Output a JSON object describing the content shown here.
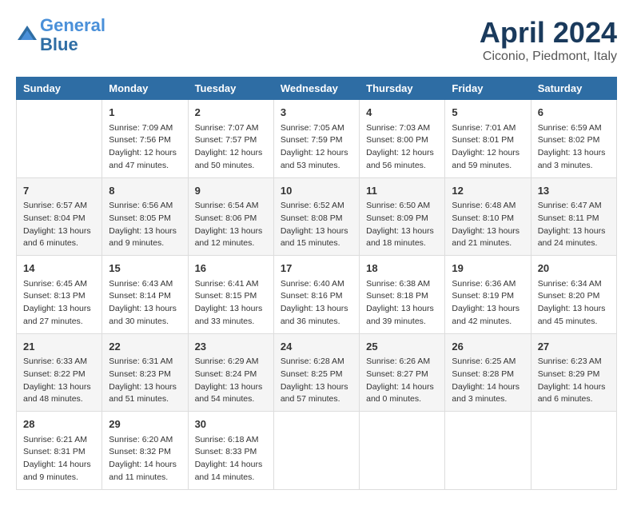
{
  "header": {
    "logo_line1": "General",
    "logo_line2": "Blue",
    "title": "April 2024",
    "subtitle": "Ciconio, Piedmont, Italy"
  },
  "days_of_week": [
    "Sunday",
    "Monday",
    "Tuesday",
    "Wednesday",
    "Thursday",
    "Friday",
    "Saturday"
  ],
  "weeks": [
    [
      {
        "day": "",
        "info": ""
      },
      {
        "day": "1",
        "info": "Sunrise: 7:09 AM\nSunset: 7:56 PM\nDaylight: 12 hours\nand 47 minutes."
      },
      {
        "day": "2",
        "info": "Sunrise: 7:07 AM\nSunset: 7:57 PM\nDaylight: 12 hours\nand 50 minutes."
      },
      {
        "day": "3",
        "info": "Sunrise: 7:05 AM\nSunset: 7:59 PM\nDaylight: 12 hours\nand 53 minutes."
      },
      {
        "day": "4",
        "info": "Sunrise: 7:03 AM\nSunset: 8:00 PM\nDaylight: 12 hours\nand 56 minutes."
      },
      {
        "day": "5",
        "info": "Sunrise: 7:01 AM\nSunset: 8:01 PM\nDaylight: 12 hours\nand 59 minutes."
      },
      {
        "day": "6",
        "info": "Sunrise: 6:59 AM\nSunset: 8:02 PM\nDaylight: 13 hours\nand 3 minutes."
      }
    ],
    [
      {
        "day": "7",
        "info": "Sunrise: 6:57 AM\nSunset: 8:04 PM\nDaylight: 13 hours\nand 6 minutes."
      },
      {
        "day": "8",
        "info": "Sunrise: 6:56 AM\nSunset: 8:05 PM\nDaylight: 13 hours\nand 9 minutes."
      },
      {
        "day": "9",
        "info": "Sunrise: 6:54 AM\nSunset: 8:06 PM\nDaylight: 13 hours\nand 12 minutes."
      },
      {
        "day": "10",
        "info": "Sunrise: 6:52 AM\nSunset: 8:08 PM\nDaylight: 13 hours\nand 15 minutes."
      },
      {
        "day": "11",
        "info": "Sunrise: 6:50 AM\nSunset: 8:09 PM\nDaylight: 13 hours\nand 18 minutes."
      },
      {
        "day": "12",
        "info": "Sunrise: 6:48 AM\nSunset: 8:10 PM\nDaylight: 13 hours\nand 21 minutes."
      },
      {
        "day": "13",
        "info": "Sunrise: 6:47 AM\nSunset: 8:11 PM\nDaylight: 13 hours\nand 24 minutes."
      }
    ],
    [
      {
        "day": "14",
        "info": "Sunrise: 6:45 AM\nSunset: 8:13 PM\nDaylight: 13 hours\nand 27 minutes."
      },
      {
        "day": "15",
        "info": "Sunrise: 6:43 AM\nSunset: 8:14 PM\nDaylight: 13 hours\nand 30 minutes."
      },
      {
        "day": "16",
        "info": "Sunrise: 6:41 AM\nSunset: 8:15 PM\nDaylight: 13 hours\nand 33 minutes."
      },
      {
        "day": "17",
        "info": "Sunrise: 6:40 AM\nSunset: 8:16 PM\nDaylight: 13 hours\nand 36 minutes."
      },
      {
        "day": "18",
        "info": "Sunrise: 6:38 AM\nSunset: 8:18 PM\nDaylight: 13 hours\nand 39 minutes."
      },
      {
        "day": "19",
        "info": "Sunrise: 6:36 AM\nSunset: 8:19 PM\nDaylight: 13 hours\nand 42 minutes."
      },
      {
        "day": "20",
        "info": "Sunrise: 6:34 AM\nSunset: 8:20 PM\nDaylight: 13 hours\nand 45 minutes."
      }
    ],
    [
      {
        "day": "21",
        "info": "Sunrise: 6:33 AM\nSunset: 8:22 PM\nDaylight: 13 hours\nand 48 minutes."
      },
      {
        "day": "22",
        "info": "Sunrise: 6:31 AM\nSunset: 8:23 PM\nDaylight: 13 hours\nand 51 minutes."
      },
      {
        "day": "23",
        "info": "Sunrise: 6:29 AM\nSunset: 8:24 PM\nDaylight: 13 hours\nand 54 minutes."
      },
      {
        "day": "24",
        "info": "Sunrise: 6:28 AM\nSunset: 8:25 PM\nDaylight: 13 hours\nand 57 minutes."
      },
      {
        "day": "25",
        "info": "Sunrise: 6:26 AM\nSunset: 8:27 PM\nDaylight: 14 hours\nand 0 minutes."
      },
      {
        "day": "26",
        "info": "Sunrise: 6:25 AM\nSunset: 8:28 PM\nDaylight: 14 hours\nand 3 minutes."
      },
      {
        "day": "27",
        "info": "Sunrise: 6:23 AM\nSunset: 8:29 PM\nDaylight: 14 hours\nand 6 minutes."
      }
    ],
    [
      {
        "day": "28",
        "info": "Sunrise: 6:21 AM\nSunset: 8:31 PM\nDaylight: 14 hours\nand 9 minutes."
      },
      {
        "day": "29",
        "info": "Sunrise: 6:20 AM\nSunset: 8:32 PM\nDaylight: 14 hours\nand 11 minutes."
      },
      {
        "day": "30",
        "info": "Sunrise: 6:18 AM\nSunset: 8:33 PM\nDaylight: 14 hours\nand 14 minutes."
      },
      {
        "day": "",
        "info": ""
      },
      {
        "day": "",
        "info": ""
      },
      {
        "day": "",
        "info": ""
      },
      {
        "day": "",
        "info": ""
      }
    ]
  ]
}
